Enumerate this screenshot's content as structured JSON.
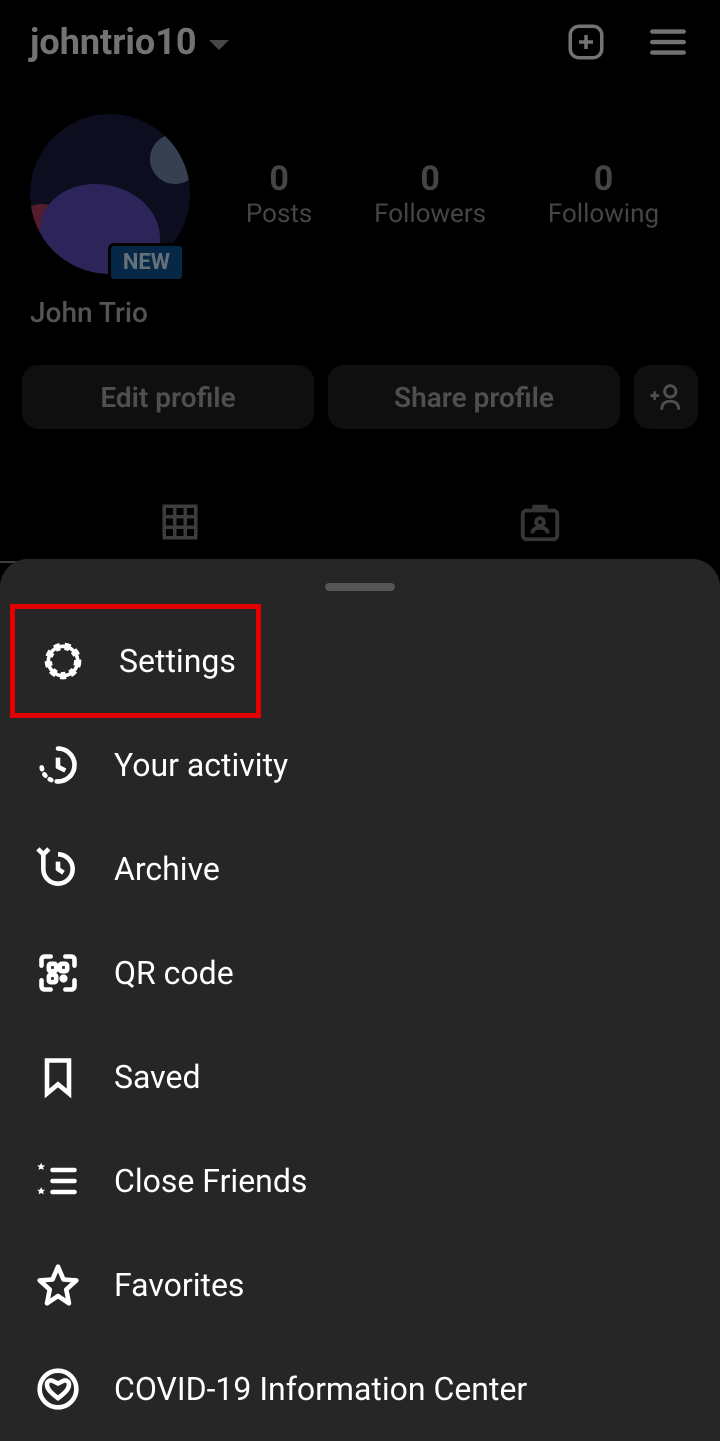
{
  "header": {
    "username": "johntrio10"
  },
  "profile": {
    "new_badge": "NEW",
    "display_name": "John Trio",
    "stats": [
      {
        "count": "0",
        "label": "Posts"
      },
      {
        "count": "0",
        "label": "Followers"
      },
      {
        "count": "0",
        "label": "Following"
      }
    ],
    "edit_button": "Edit profile",
    "share_button": "Share profile"
  },
  "menu": {
    "items": [
      {
        "label": "Settings",
        "icon": "gear",
        "highlighted": true
      },
      {
        "label": "Your activity",
        "icon": "activity"
      },
      {
        "label": "Archive",
        "icon": "archive"
      },
      {
        "label": "QR code",
        "icon": "qr"
      },
      {
        "label": "Saved",
        "icon": "bookmark"
      },
      {
        "label": "Close Friends",
        "icon": "closefriends"
      },
      {
        "label": "Favorites",
        "icon": "star"
      },
      {
        "label": "COVID-19 Information Center",
        "icon": "heart"
      }
    ]
  }
}
